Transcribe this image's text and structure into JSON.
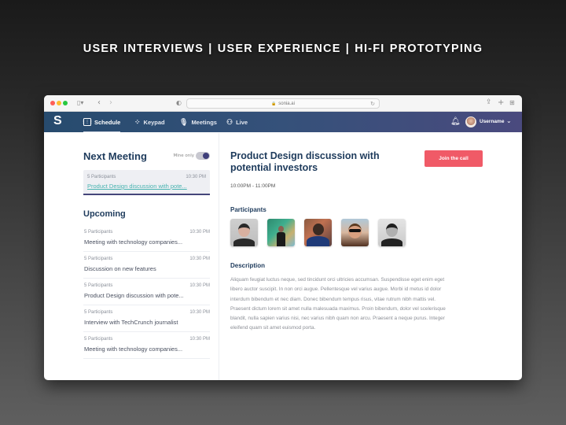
{
  "tagline": "USER INTERVIEWS  |  USER EXPERIENCE  |  HI-FI PROTOTYPING",
  "browser": {
    "url": "sonia.ai",
    "icons": [
      "sidebar-icon",
      "chevron-left-icon",
      "chevron-right-icon",
      "shield-icon",
      "lock-icon",
      "reload-icon",
      "share-icon",
      "new-tab-icon",
      "tab-overview-icon"
    ]
  },
  "navbar": {
    "logo": "S",
    "items": [
      {
        "label": "Schedule",
        "icon": "calendar-icon",
        "active": true
      },
      {
        "label": "Keypad",
        "icon": "keypad-icon",
        "active": false
      },
      {
        "label": "Meetings",
        "icon": "microphone-icon",
        "active": false
      },
      {
        "label": "Live",
        "icon": "live-icon",
        "active": false
      }
    ],
    "username": "Username"
  },
  "next_meeting": {
    "heading": "Next Meeting",
    "toggle_label": "Mine only",
    "toggle_on": true,
    "card": {
      "participants": "5 Participants",
      "time": "10:30 PM",
      "title": "Product Design discussion with pote..."
    }
  },
  "upcoming": {
    "heading": "Upcoming",
    "items": [
      {
        "participants": "5 Participants",
        "time": "10:30 PM",
        "title": "Meeting with technology companies..."
      },
      {
        "participants": "5 Participants",
        "time": "10:30 PM",
        "title": "Discussion on new features"
      },
      {
        "participants": "5 Participants",
        "time": "10:30 PM",
        "title": "Product Design discussion with pote..."
      },
      {
        "participants": "5 Participants",
        "time": "10:30 PM",
        "title": "Interview with TechCrunch journalist"
      },
      {
        "participants": "5 Participants",
        "time": "10:30 PM",
        "title": "Meeting with technology companies..."
      }
    ]
  },
  "detail": {
    "title": "Product Design discussion with potential investors",
    "join_label": "Join the call",
    "time_range": "10:00PM - 11:00PM",
    "participants_heading": "Participants",
    "participants_count": 5,
    "description_heading": "Description",
    "description": "Aliquam feugiat luctus neque, sed tincidunt orci ultricies accumsan. Suspendisse eget enim eget libero auctor suscipit. In non orci augue. Pellentesque vel varius augue. Morbi id metus id dolor interdum bibendum et nec diam. Donec bibendum tempus risus, vitae rutrum nibh mattis vel. Praesent dictum lorem sit amet nulla malesuada maximus. Proin bibendum, dolor vel scelerisque blandit, nulla sapien varius nisi, nec varius nibh quam non arcu. Praesent a neque purus. Integer eleifend quam sit amet euismod porta."
  },
  "colors": {
    "navy": "#1e3b5c",
    "accent_teal": "#48b3b0",
    "join_red": "#f05a67",
    "toggle_knob": "#3f3f7a"
  }
}
